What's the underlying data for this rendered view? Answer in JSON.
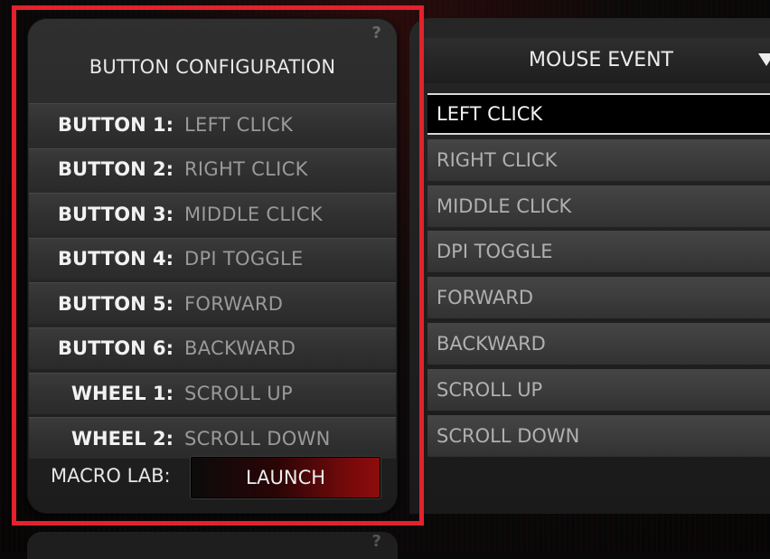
{
  "left_panel": {
    "title": "BUTTON CONFIGURATION",
    "help_symbol": "?",
    "buttons": [
      {
        "key": "BUTTON 1:",
        "value": "LEFT CLICK"
      },
      {
        "key": "BUTTON 2:",
        "value": "RIGHT CLICK"
      },
      {
        "key": "BUTTON 3:",
        "value": "MIDDLE CLICK"
      },
      {
        "key": "BUTTON 4:",
        "value": "DPI TOGGLE"
      },
      {
        "key": "BUTTON 5:",
        "value": "FORWARD"
      },
      {
        "key": "BUTTON 6:",
        "value": "BACKWARD"
      },
      {
        "key": "WHEEL 1:",
        "value": "SCROLL UP"
      },
      {
        "key": "WHEEL 2:",
        "value": "SCROLL DOWN"
      }
    ],
    "macro_label": "MACRO LAB:",
    "launch_label": "LAUNCH"
  },
  "right_panel": {
    "dropdown_title": "MOUSE EVENT",
    "events": [
      {
        "label": "LEFT CLICK",
        "selected": true
      },
      {
        "label": "RIGHT CLICK"
      },
      {
        "label": "MIDDLE CLICK"
      },
      {
        "label": "DPI TOGGLE"
      },
      {
        "label": "FORWARD"
      },
      {
        "label": "BACKWARD"
      },
      {
        "label": "SCROLL UP"
      },
      {
        "label": "SCROLL DOWN"
      }
    ]
  },
  "bottom_panel": {
    "help_symbol": "?"
  },
  "colors": {
    "highlight": "#e3222c",
    "accent_red": "#8e0c0c"
  }
}
